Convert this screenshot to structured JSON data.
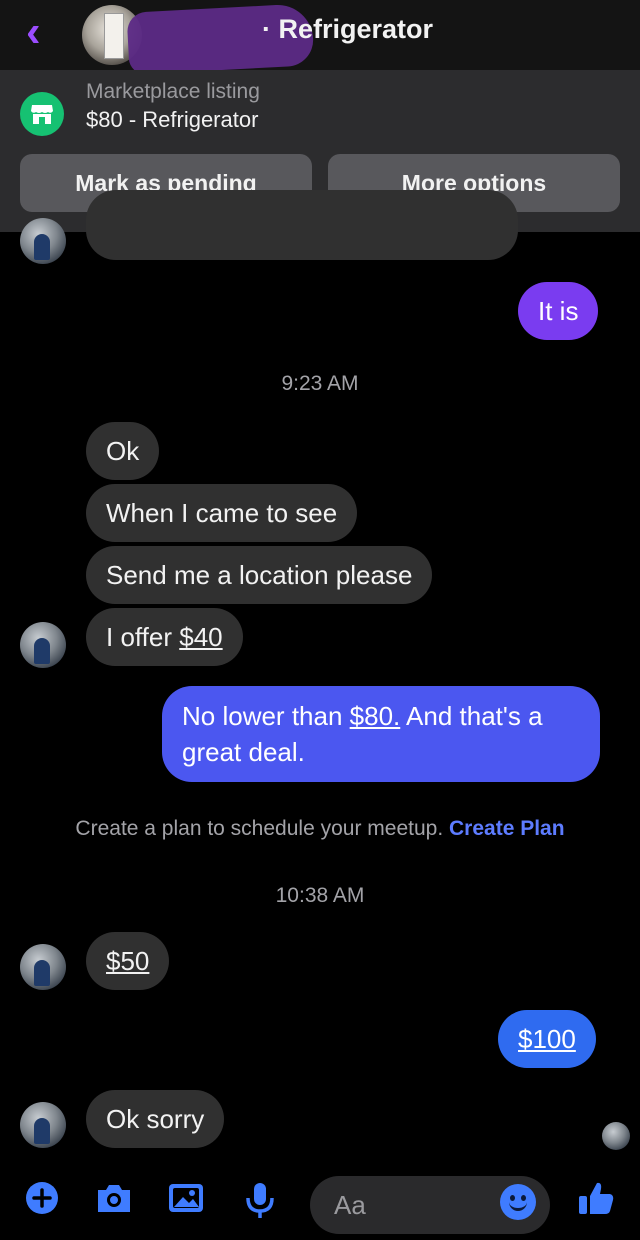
{
  "header": {
    "title": "· Refrigerator",
    "back_icon": "chevron-left-icon",
    "accent": "#9b4dff"
  },
  "listing": {
    "label": "Marketplace listing",
    "title": "$80 - Refrigerator",
    "icon": "shop-icon",
    "icon_color": "#16c172",
    "buttons": {
      "pending": "Mark as pending",
      "options": "More options"
    }
  },
  "messages": {
    "m1": "It is",
    "time1": "9:23 AM",
    "m2": "Ok",
    "m3": "When I came to see",
    "m4": "Send me a location please",
    "m5_prefix": "I offer ",
    "m5_amount": "$40",
    "m6_prefix": "No lower than ",
    "m6_amount": "$80.",
    "m6_rest1": " And that's a",
    "m6_rest2": "great deal.",
    "plan_text": "Create a plan to schedule your meetup.",
    "plan_link": "Create Plan",
    "time2": "10:38 AM",
    "m7": "$50",
    "m8": "$100",
    "m9": "Ok sorry"
  },
  "composer": {
    "placeholder": "Aa",
    "icons": [
      "plus-icon",
      "camera-icon",
      "gallery-icon",
      "microphone-icon",
      "emoji-icon",
      "thumbs-up-icon"
    ],
    "icon_color": "#3f7cff"
  }
}
